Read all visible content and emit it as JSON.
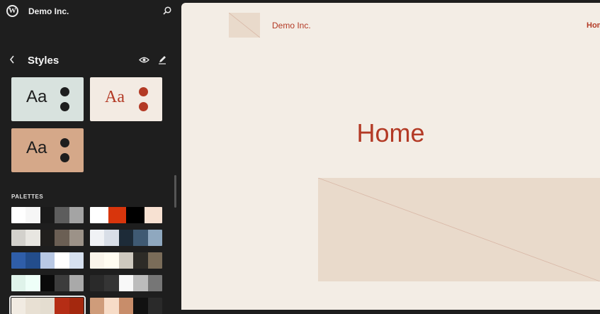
{
  "sidebar": {
    "site_name": "Demo Inc.",
    "panel_title": "Styles",
    "palettes_label": "PALETTES",
    "variations": [
      {
        "label": "Aa",
        "bg": "#d8e2de",
        "text_color": "#1e1e1e",
        "dot_color": "#1e1e1e"
      },
      {
        "label": "Aa",
        "bg": "#f3ebe3",
        "text_color": "#b33a25",
        "dot_color": "#b33a25"
      },
      {
        "label": "Aa",
        "bg": "#d5a889",
        "text_color": "#1e1e1e",
        "dot_color": "#1e1e1e"
      }
    ],
    "palettes": [
      {
        "colors": [
          "#ffffff",
          "#f6f6f6",
          "#1a1a1a",
          "#5d5d5d",
          "#a4a4a4"
        ],
        "selected": false
      },
      {
        "colors": [
          "#ffffff",
          "#d8350c",
          "#000000",
          "#f7e1d2"
        ],
        "selected": false
      },
      {
        "colors": [
          "#d3d1cc",
          "#e8e6e1",
          "#211f1d",
          "#6b5f54",
          "#9c9288"
        ],
        "selected": false
      },
      {
        "colors": [
          "#f0f2f5",
          "#d8dee7",
          "#1d2b38",
          "#3f5a73",
          "#8fa8bf"
        ],
        "selected": false
      },
      {
        "colors": [
          "#2f5ea9",
          "#234d8c",
          "#b8c8e4",
          "#ffffff",
          "#d6e0ef"
        ],
        "selected": false
      },
      {
        "colors": [
          "#f9f4ea",
          "#fffcf1",
          "#cec9bf",
          "#2d2b27",
          "#7a6c59"
        ],
        "selected": false
      },
      {
        "colors": [
          "#dff3ea",
          "#eefff8",
          "#0a0a0a",
          "#3c3c3c",
          "#a9a9a9"
        ],
        "selected": false
      },
      {
        "colors": [
          "#2a2a2a",
          "#353535",
          "#f8f8f8",
          "#bcbcbc",
          "#767676"
        ],
        "selected": false
      },
      {
        "colors": [
          "#f1ebe2",
          "#e8e0d3",
          "#e4ddd0",
          "#b52d15",
          "#a4280e"
        ],
        "selected": true
      },
      {
        "colors": [
          "#cf9c7a",
          "#f7dcc7",
          "#c88d6a",
          "#111111",
          "#2a2a2a"
        ],
        "selected": false
      }
    ]
  },
  "canvas": {
    "site_title": "Demo Inc.",
    "nav_item": "Home",
    "page_heading": "Home"
  },
  "colors": {
    "accent": "#b33a25",
    "canvas_bg": "#f3ede5",
    "placeholder": "#e9dacb",
    "sidebar_bg": "#1e1e1e"
  }
}
